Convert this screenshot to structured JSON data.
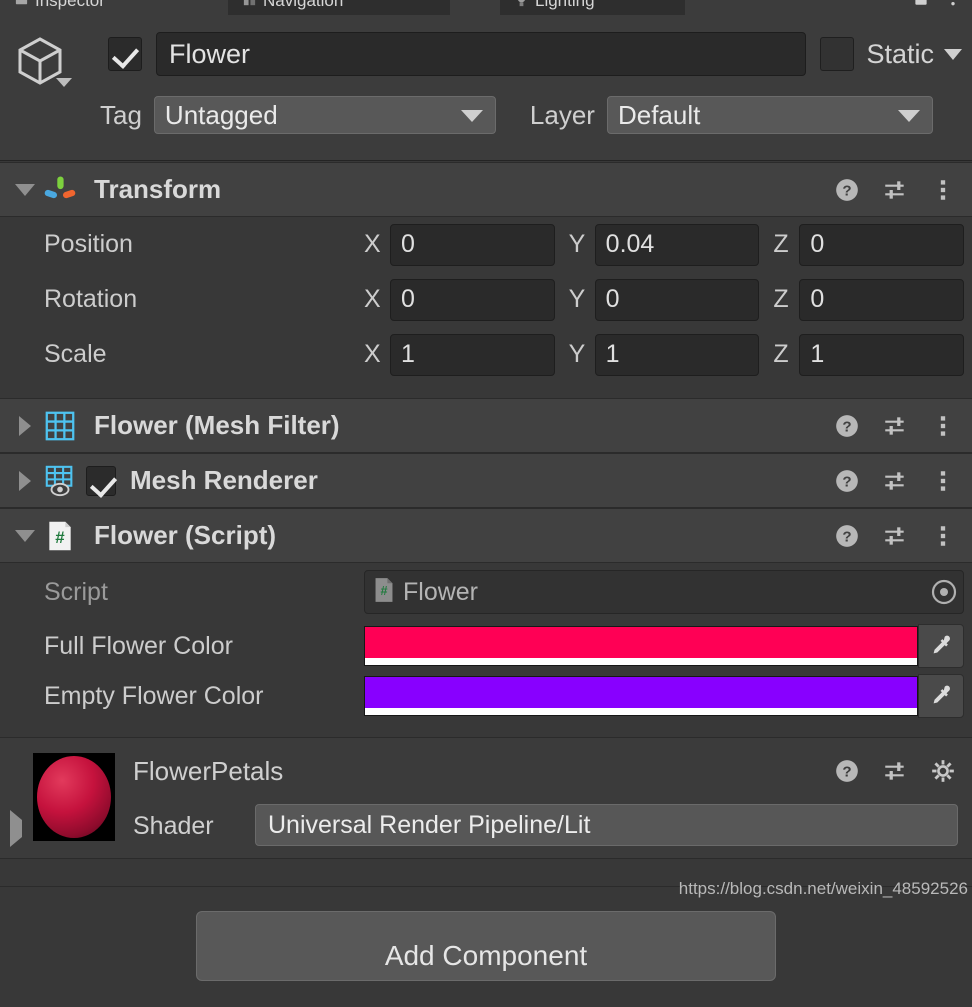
{
  "window": {
    "tabs": [
      {
        "label": "Inspector",
        "icon": "inspector-icon",
        "active": true
      },
      {
        "label": "Navigation",
        "icon": "navigation-icon",
        "active": false
      },
      {
        "label": "Lighting",
        "icon": "lighting-icon",
        "active": false
      }
    ],
    "lock_icon": "lock-icon",
    "menu_icon": "kebab-menu-icon"
  },
  "game_object": {
    "enabled_checkbox": true,
    "name": "Flower",
    "static_label": "Static",
    "static_checked": false,
    "tag_label": "Tag",
    "tag_value": "Untagged",
    "layer_label": "Layer",
    "layer_value": "Default"
  },
  "components": [
    {
      "title": "Transform",
      "expanded": true,
      "icon": "transform-axis-icon",
      "rows": [
        {
          "label": "Position",
          "x": "0",
          "y": "0.04",
          "z": "0"
        },
        {
          "label": "Rotation",
          "x": "0",
          "y": "0",
          "z": "0"
        },
        {
          "label": "Scale",
          "x": "1",
          "y": "1",
          "z": "1"
        }
      ],
      "axis_labels": {
        "x": "X",
        "y": "Y",
        "z": "Z"
      }
    },
    {
      "title": "Flower (Mesh Filter)",
      "expanded": false,
      "icon": "mesh-filter-icon",
      "has_enable_checkbox": false
    },
    {
      "title": "Mesh Renderer",
      "expanded": false,
      "icon": "mesh-renderer-icon",
      "has_enable_checkbox": true,
      "enabled": true
    },
    {
      "title": "Flower (Script)",
      "expanded": true,
      "icon": "csharp-script-icon",
      "script_row": {
        "label": "Script",
        "value": "Flower",
        "icon": "csharp-script-icon",
        "picker_icon": "object-picker-icon"
      },
      "color_rows": [
        {
          "label": "Full Flower Color",
          "color": "#FF0055",
          "alpha_bar": "#FFFFFF",
          "eyedropper_icon": "eyedropper-icon"
        },
        {
          "label": "Empty Flower Color",
          "color": "#8800FF",
          "alpha_bar": "#FFFFFF",
          "eyedropper_icon": "eyedropper-icon"
        }
      ]
    }
  ],
  "material": {
    "name": "FlowerPetals",
    "preview_color": "#C5123D",
    "shader_label": "Shader",
    "shader_value": "Universal Render Pipeline/Lit",
    "expanded": false
  },
  "header_actions": {
    "help_icon": "help-icon",
    "preset_icon": "preset-settings-icon",
    "menu_icon": "kebab-menu-icon",
    "gear_icon": "gear-icon"
  },
  "footer": {
    "add_component_label": "Add Component",
    "watermark": "https://blog.csdn.net/weixin_48592526"
  },
  "colors": {
    "panel_bg": "#383838",
    "header_bg": "#3c3c3c",
    "component_header_bg": "#414141",
    "field_bg": "#2a2a2a",
    "dropdown_bg": "#585858",
    "text": "#c4c4c4",
    "icon_blue": "#4ec3f0",
    "axis_green": "#7dd13e",
    "axis_blue": "#4aa8e0",
    "axis_orange": "#f0652f"
  }
}
